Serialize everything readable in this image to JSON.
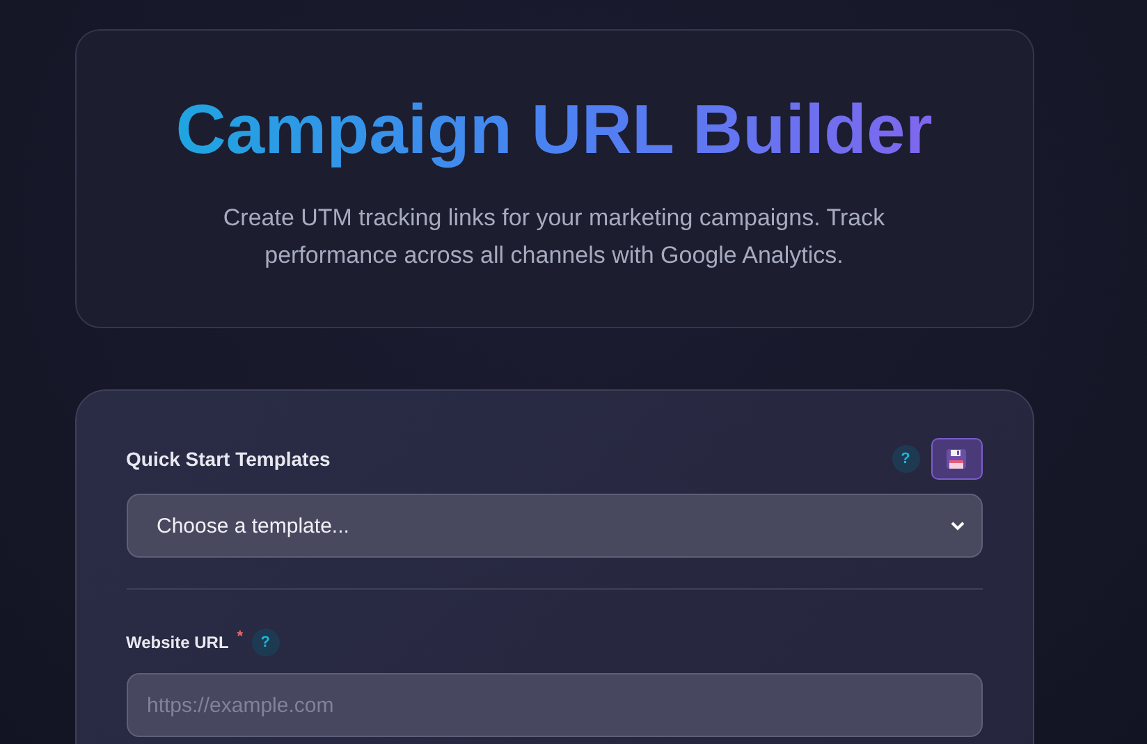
{
  "header": {
    "title": "Campaign URL Builder",
    "description": "Create UTM tracking links for your marketing campaigns. Track performance across all channels with Google Analytics."
  },
  "templates": {
    "label": "Quick Start Templates",
    "help": "?",
    "select": {
      "value": "Choose a template..."
    }
  },
  "fields": [
    {
      "label": "Website URL",
      "required": true,
      "required_mark": "*",
      "help": "?",
      "placeholder": "https://example.com"
    }
  ]
}
